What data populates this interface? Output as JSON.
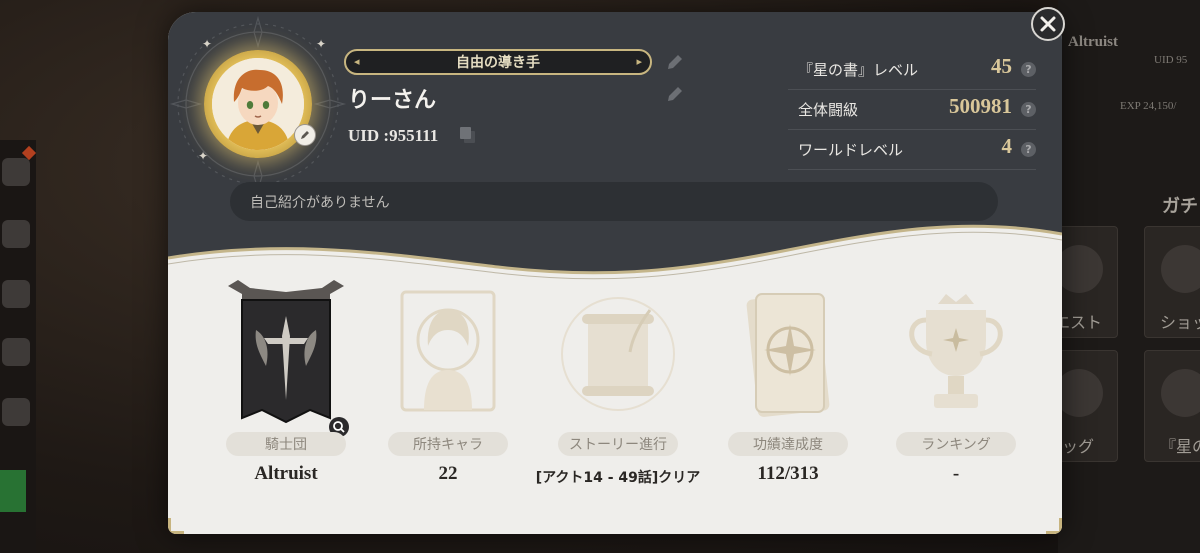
{
  "profile": {
    "title": "自由の導き手",
    "name": "りーさん",
    "uid": "UID :955111",
    "intro": "自己紹介がありません"
  },
  "stats": [
    {
      "label": "『星の書』レベル",
      "value": "45"
    },
    {
      "label": "全体闘級",
      "value": "500981"
    },
    {
      "label": "ワールドレベル",
      "value": "4"
    }
  ],
  "help_glyph": "?",
  "cards": [
    {
      "label": "騎士団",
      "value": "Altruist"
    },
    {
      "label": "所持キャラ",
      "value": "22"
    },
    {
      "label": "ストーリー進行",
      "value": "[アクト14 - 49話]クリア"
    },
    {
      "label": "功績達成度",
      "value": "112/313"
    },
    {
      "label": "ランキング",
      "value": "-"
    }
  ],
  "background": {
    "right_texts": [
      "Altruist",
      "UID 95",
      "EXP 24,150/",
      "ガチ"
    ],
    "right_tiles": [
      "エスト",
      "ショッ",
      "ッグ",
      "『星の"
    ]
  },
  "colors": {
    "header_bg": "#393c41",
    "body_bg": "#efeeeb",
    "gold": "#d9c79a",
    "title_border": "#c8b680"
  },
  "icons": [
    "close-icon",
    "pencil-icon",
    "copy-icon",
    "help-icon",
    "magnifier-icon",
    "knight-banner-icon",
    "character-icon",
    "scroll-icon",
    "achievement-book-icon",
    "trophy-icon"
  ]
}
